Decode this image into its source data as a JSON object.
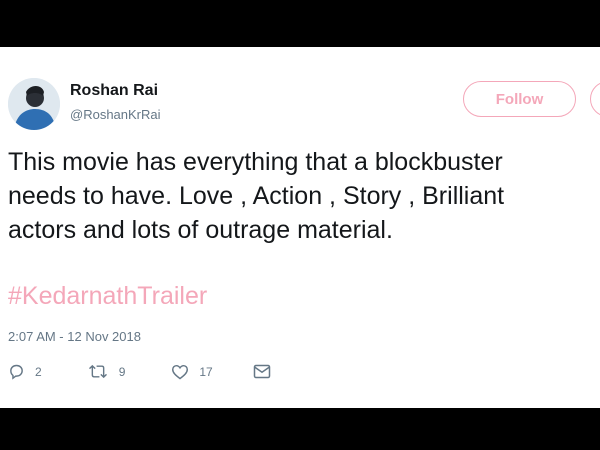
{
  "tweet": {
    "author_name": "Roshan Rai",
    "author_handle": "@RoshanKrRai",
    "follow_label": "Follow",
    "text_lines": [
      "This movie has everything that a blockbuster",
      "needs to have. Love , Action , Story , Brilliant",
      "actors and lots of outrage material."
    ],
    "hashtag": "#KedarnathTrailer",
    "timestamp": "2:07 AM - 12 Nov 2018",
    "actions": {
      "reply_count": "2",
      "retweet_count": "9",
      "like_count": "17"
    },
    "icons": {
      "reply": "reply-icon",
      "retweet": "retweet-icon",
      "like": "heart-icon",
      "message": "envelope-icon"
    },
    "colors": {
      "accent": "#f4a7b9",
      "text": "#14171a",
      "secondary": "#657786",
      "frame": "#000000"
    }
  }
}
